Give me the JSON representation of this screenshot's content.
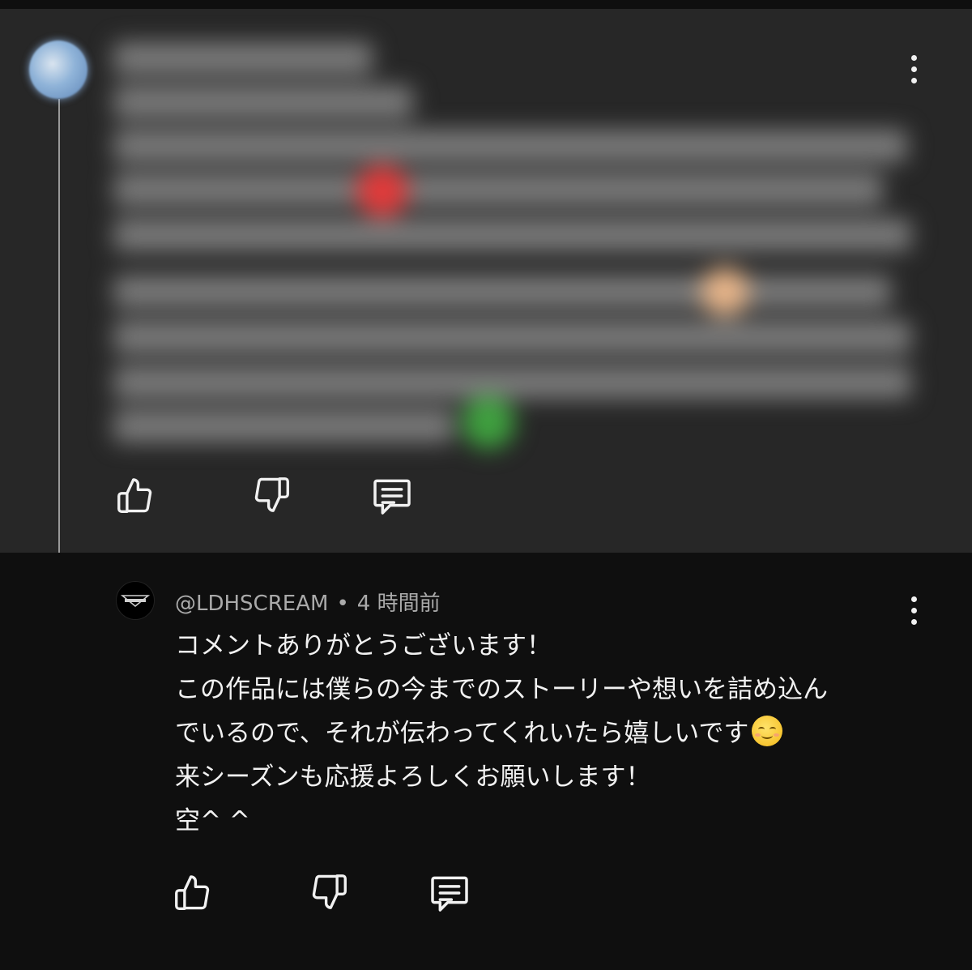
{
  "parent_comment": {
    "text_visible": false
  },
  "reply": {
    "author": "@LDHSCREAM",
    "separator": "•",
    "time": "4 時間前",
    "body_lines": [
      "コメントありがとうございます！",
      "この作品には僕らの今までのストーリーや想いを詰め込ん",
      "でいるので、それが伝わってくれいたら嬉しいです",
      "来シーズンも応援よろしくお願いします！",
      "空^ ^"
    ],
    "emoji": "smiling-face-icon"
  },
  "icons": {
    "like": "thumbs-up-icon",
    "dislike": "thumbs-down-icon",
    "reply": "comment-icon",
    "menu": "more-vert-icon"
  },
  "colors": {
    "parent_bg": "#272727",
    "reply_bg": "#0f0f0f",
    "text": "#f1f1f1",
    "meta": "#aaaaaa"
  }
}
